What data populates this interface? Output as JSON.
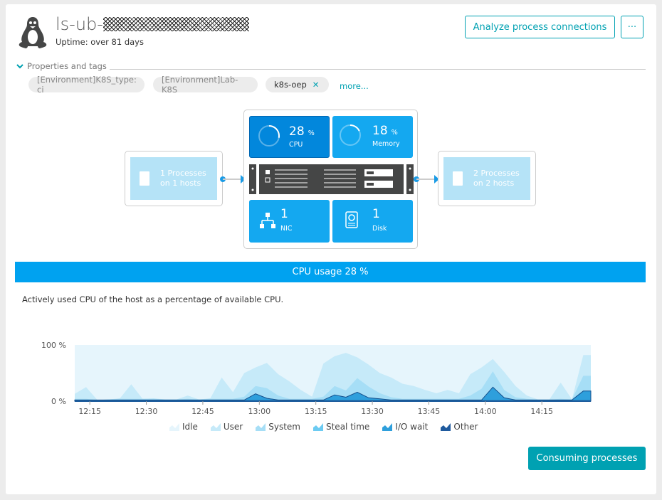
{
  "header": {
    "title_prefix": "ls-ub-",
    "uptime": "Uptime: over 81 days",
    "analyze_button": "Analyze process connections",
    "more_button": "···",
    "os_icon": "linux-tux-icon"
  },
  "properties": {
    "label": "Properties and tags",
    "tags": [
      "[Environment]K8S_type: ci",
      "[Environment]Lab-K8S",
      "k8s-oep"
    ],
    "more_link": "more..."
  },
  "infographic": {
    "incoming": {
      "line1": "1 Processes",
      "line2": "on 1 hosts"
    },
    "outgoing": {
      "line1": "2 Processes",
      "line2": "on 2 hosts"
    },
    "cpu": {
      "value": "28",
      "unit": "%",
      "label": "CPU",
      "percent": 28
    },
    "memory": {
      "value": "18",
      "unit": "%",
      "label": "Memory",
      "percent": 18
    },
    "nic": {
      "value": "1",
      "label": "NIC"
    },
    "disk": {
      "value": "1",
      "label": "Disk"
    }
  },
  "banner": "CPU usage 28 %",
  "description": "Actively used CPU of the host as a percentage of available CPU.",
  "consuming_button": "Consuming processes",
  "chart_data": {
    "type": "area",
    "stacked": true,
    "xlim": [
      "12:11",
      "14:28"
    ],
    "ylim": [
      0,
      100
    ],
    "y_ticks": [
      "0 %",
      "100 %"
    ],
    "x_ticks": [
      "12:15",
      "12:30",
      "12:45",
      "13:00",
      "13:15",
      "13:30",
      "13:45",
      "14:00",
      "14:15"
    ],
    "legend_position": "bottom",
    "x": [
      "12:11",
      "12:14",
      "12:17",
      "12:20",
      "12:23",
      "12:26",
      "12:29",
      "12:32",
      "12:35",
      "12:38",
      "12:41",
      "12:44",
      "12:47",
      "12:50",
      "12:53",
      "12:56",
      "12:59",
      "13:02",
      "13:05",
      "13:08",
      "13:11",
      "13:14",
      "13:17",
      "13:20",
      "13:23",
      "13:26",
      "13:29",
      "13:32",
      "13:35",
      "13:38",
      "13:41",
      "13:44",
      "13:47",
      "13:50",
      "13:53",
      "13:56",
      "13:59",
      "14:02",
      "14:05",
      "14:08",
      "14:11",
      "14:14",
      "14:17",
      "14:20",
      "14:23",
      "14:26"
    ],
    "series": [
      {
        "name": "Other",
        "color": "#1f5a9e",
        "values": [
          1,
          1,
          1,
          1,
          1,
          1,
          1,
          1,
          1,
          1,
          1,
          1,
          1,
          1,
          1,
          1,
          1,
          1,
          1,
          1,
          1,
          1,
          1,
          1,
          1,
          1,
          1,
          1,
          1,
          1,
          1,
          1,
          1,
          1,
          1,
          1,
          1,
          1,
          1,
          1,
          1,
          1,
          1,
          1,
          1,
          1
        ]
      },
      {
        "name": "I/O wait",
        "color": "#2e9fdc",
        "values": [
          1,
          1,
          1,
          1,
          1,
          1,
          1,
          1,
          1,
          1,
          1,
          1,
          1,
          1,
          1,
          1,
          12,
          4,
          1,
          1,
          1,
          1,
          1,
          10,
          6,
          15,
          5,
          3,
          1,
          1,
          1,
          1,
          1,
          1,
          1,
          1,
          1,
          24,
          5,
          1,
          1,
          1,
          1,
          1,
          1,
          17
        ]
      },
      {
        "name": "Steal time",
        "color": "#6ccbf2",
        "values": [
          0,
          0,
          0,
          0,
          0,
          0,
          0,
          0,
          0,
          0,
          0,
          0,
          0,
          0,
          0,
          0,
          0,
          0,
          0,
          0,
          0,
          0,
          0,
          0,
          0,
          0,
          0,
          0,
          0,
          0,
          0,
          0,
          0,
          0,
          0,
          0,
          0,
          0,
          0,
          0,
          0,
          0,
          0,
          0,
          0,
          0
        ]
      },
      {
        "name": "System",
        "color": "#a6def6",
        "values": [
          2,
          2,
          0,
          1,
          2,
          2,
          2,
          2,
          1,
          1,
          2,
          1,
          2,
          2,
          2,
          6,
          14,
          18,
          8,
          2,
          2,
          2,
          6,
          16,
          12,
          25,
          20,
          10,
          5,
          2,
          2,
          2,
          2,
          2,
          2,
          8,
          20,
          28,
          14,
          5,
          2,
          1,
          1,
          2,
          1,
          27
        ]
      },
      {
        "name": "User",
        "color": "#c6eaf9",
        "values": [
          9,
          21,
          0,
          0,
          1,
          26,
          0,
          1,
          0,
          0,
          6,
          0,
          1,
          38,
          12,
          42,
          33,
          45,
          38,
          31,
          16,
          4,
          59,
          53,
          67,
          37,
          39,
          36,
          35,
          27,
          23,
          16,
          10,
          16,
          10,
          38,
          38,
          22,
          32,
          20,
          6,
          0,
          0,
          29,
          0,
          37
        ]
      },
      {
        "name": "Idle",
        "color": "#e6f5fc",
        "values": "remainder"
      }
    ],
    "legend": [
      "Idle",
      "User",
      "System",
      "Steal time",
      "I/O wait",
      "Other"
    ]
  }
}
